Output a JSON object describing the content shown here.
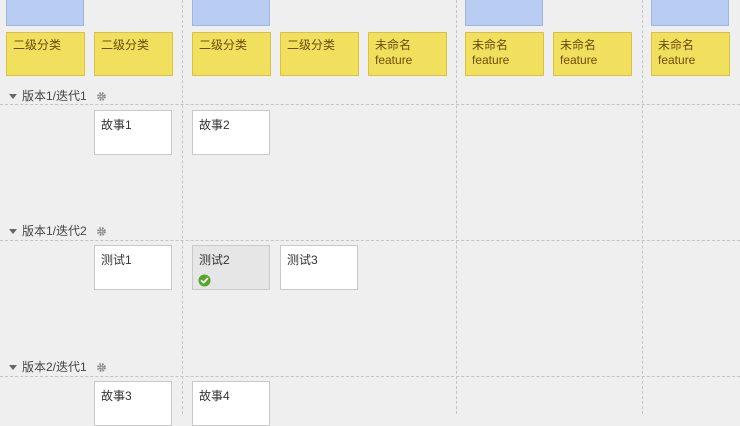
{
  "header": {
    "level2_labels": [
      "二级分类",
      "二级分类",
      "二级分类",
      "二级分类"
    ],
    "unnamed_features": [
      {
        "line1": "未命名",
        "line2": "feature"
      },
      {
        "line1": "未命名",
        "line2": "feature"
      },
      {
        "line1": "未命名",
        "line2": "feature"
      },
      {
        "line1": "未命名",
        "line2": "feature"
      }
    ]
  },
  "rows": [
    {
      "label": "版本1/迭代1",
      "cards": [
        "故事1",
        "故事2"
      ]
    },
    {
      "label": "版本1/迭代2",
      "cards": [
        "测试1",
        "测试2",
        "测试3"
      ]
    },
    {
      "label": "版本2/迭代1",
      "cards": [
        "故事3",
        "故事4"
      ]
    }
  ],
  "colors": {
    "epic_blue": "#b9cdf2",
    "feature_yellow": "#f1e05e",
    "done_check": "#5aa62d"
  },
  "icons": {
    "collapse": "caret-down-icon",
    "settings": "gear-icon",
    "done": "check-circle-icon"
  }
}
